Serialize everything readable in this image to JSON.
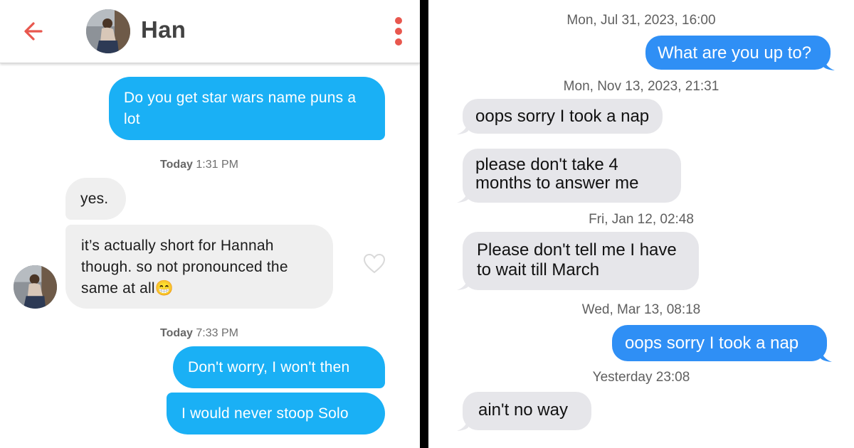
{
  "left_chat": {
    "header": {
      "contact_name": "Han"
    },
    "messages": [
      {
        "kind": "out",
        "text": "Do you get star wars name puns a lot"
      },
      {
        "kind": "timestamp",
        "day": "Today",
        "time": "1:31 PM"
      },
      {
        "kind": "in",
        "text": "yes."
      },
      {
        "kind": "in",
        "text": "it’s actually short for Hannah though. so not pronounced the same at all😁"
      },
      {
        "kind": "timestamp",
        "day": "Today",
        "time": "7:33 PM"
      },
      {
        "kind": "out",
        "text": "Don't worry, I won't then"
      },
      {
        "kind": "out",
        "text": "I would never stoop Solo"
      }
    ]
  },
  "right_chat": {
    "items": [
      {
        "kind": "timestamp",
        "text": "Mon, Jul 31, 2023, 16:00"
      },
      {
        "kind": "out",
        "text": "What are you up to?"
      },
      {
        "kind": "timestamp",
        "text": "Mon, Nov 13, 2023, 21:31"
      },
      {
        "kind": "in",
        "text": "oops sorry I took a nap"
      },
      {
        "kind": "in",
        "text": "please don't take 4 months to answer me"
      },
      {
        "kind": "timestamp",
        "text": "Fri, Jan 12, 02:48"
      },
      {
        "kind": "in",
        "text": "Please don't tell me I have to wait till March"
      },
      {
        "kind": "timestamp",
        "text": "Wed, Mar 13, 08:18"
      },
      {
        "kind": "out",
        "text": "oops sorry I took a nap"
      },
      {
        "kind": "timestamp",
        "text": "Yesterday 23:08"
      },
      {
        "kind": "in",
        "text": "ain't no way"
      }
    ]
  },
  "colors": {
    "tinder_outgoing": "#1ab0f5",
    "tinder_incoming": "#efefef",
    "tinder_accent": "#e8574e",
    "imessage_outgoing": "#2f8ff5",
    "imessage_incoming": "#e6e6ea"
  },
  "icons": [
    "back-arrow-icon",
    "more-options-icon",
    "heart-icon"
  ]
}
